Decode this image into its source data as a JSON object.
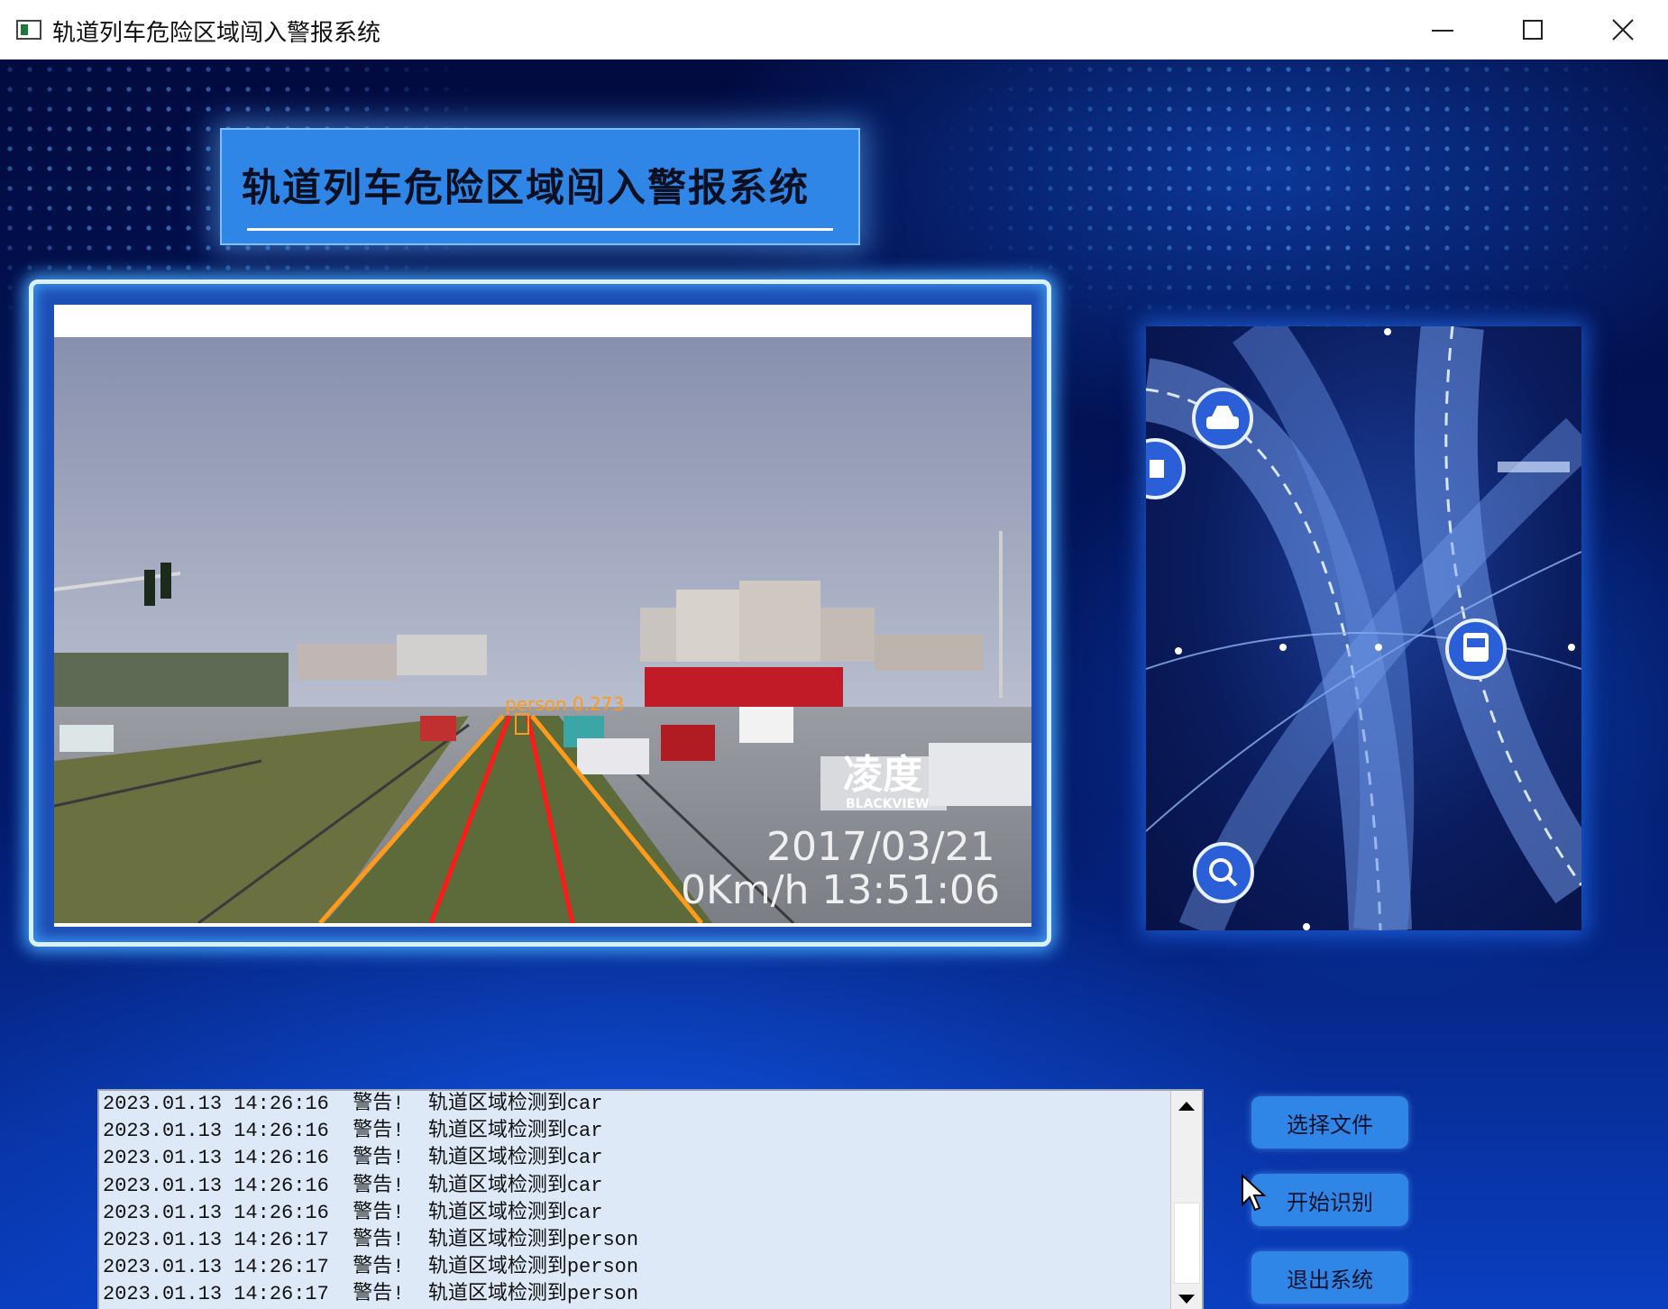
{
  "window": {
    "title": "轨道列车危险区域闯入警报系统"
  },
  "banner": {
    "title": "轨道列车危险区域闯入警报系统"
  },
  "video": {
    "detection_label": "person 0.273",
    "watermark_brand": "凌度",
    "watermark_sub": "BLACKVIEW",
    "date": "2017/03/21",
    "speed_time": "0Km/h 13:51:06"
  },
  "log": {
    "lines": [
      "2023.01.13 14:26:16  警告!  轨道区域检测到car",
      "2023.01.13 14:26:16  警告!  轨道区域检测到car",
      "2023.01.13 14:26:16  警告!  轨道区域检测到car",
      "2023.01.13 14:26:16  警告!  轨道区域检测到car",
      "2023.01.13 14:26:16  警告!  轨道区域检测到car",
      "2023.01.13 14:26:17  警告!  轨道区域检测到person",
      "2023.01.13 14:26:17  警告!  轨道区域检测到person",
      "2023.01.13 14:26:17  警告!  轨道区域检测到person"
    ]
  },
  "buttons": {
    "select_file": "选择文件",
    "start_recognition": "开始识别",
    "exit_system": "退出系统"
  },
  "colors": {
    "accent": "#2f86e6",
    "background": "#031a6b",
    "frame_glow": "#46aaff",
    "rail_red": "#ff1a1a",
    "rail_orange": "#ff9a1a"
  },
  "icons": {
    "side_panel": [
      "car-icon",
      "truck-icon",
      "bus-icon",
      "search-icon"
    ]
  }
}
